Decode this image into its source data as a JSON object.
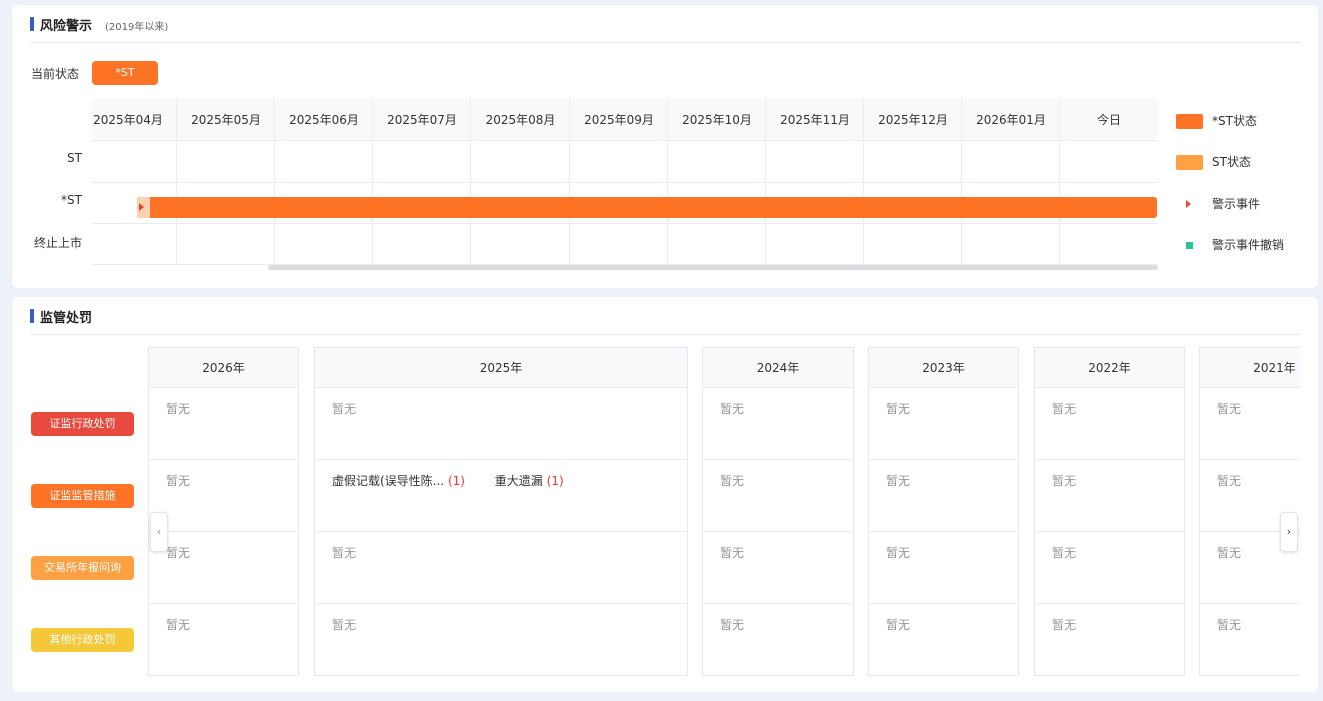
{
  "risk": {
    "title": "风险警示",
    "subtitle": "(2019年以来)",
    "current_label": "当前状态",
    "current_badge": "*ST",
    "rows": [
      "ST",
      "*ST",
      "终止上市"
    ],
    "months": [
      "2025年04月",
      "2025年05月",
      "2025年06月",
      "2025年07月",
      "2025年08月",
      "2025年09月",
      "2025年10月",
      "2025年11月",
      "2025年12月",
      "2026年01月",
      "今日"
    ],
    "legend": [
      {
        "label": "*ST状态",
        "icon": "orange-swatch",
        "color": "#ff7326"
      },
      {
        "label": "ST状态",
        "icon": "light-orange-swatch",
        "color": "#ffa043"
      },
      {
        "label": "警示事件",
        "icon": "red-triangle-icon",
        "color": "#e34a2d"
      },
      {
        "label": "警示事件撤销",
        "icon": "green-square-icon",
        "color": "#2fc38e"
      }
    ],
    "colors": {
      "star_st": "#ff7326",
      "st": "#ffa043"
    }
  },
  "penalty": {
    "title": "监管处罚",
    "categories": [
      {
        "label": "证监行政处罚",
        "color": "#e84a3f"
      },
      {
        "label": "证监监管措施",
        "color": "#ff7326"
      },
      {
        "label": "交易所年报问询",
        "color": "#ffa043"
      },
      {
        "label": "其他行政处罚",
        "color": "#f5c83a"
      }
    ],
    "empty_text": "暂无",
    "years": [
      {
        "year": "2026年",
        "cells": [
          [],
          [],
          [],
          []
        ]
      },
      {
        "year": "2025年",
        "cells": [
          [],
          [
            {
              "text": "虚假记载(误导性陈...",
              "count": "(1)"
            },
            {
              "text": "重大遗漏",
              "count": "(1)"
            }
          ],
          [],
          []
        ]
      },
      {
        "year": "2024年",
        "cells": [
          [],
          [],
          [],
          []
        ]
      },
      {
        "year": "2023年",
        "cells": [
          [],
          [],
          [],
          []
        ]
      },
      {
        "year": "2022年",
        "cells": [
          [],
          [],
          [],
          []
        ]
      },
      {
        "year": "2021年",
        "cells": [
          [],
          [],
          [],
          []
        ]
      }
    ],
    "prev_icon": "‹",
    "next_icon": "›"
  }
}
